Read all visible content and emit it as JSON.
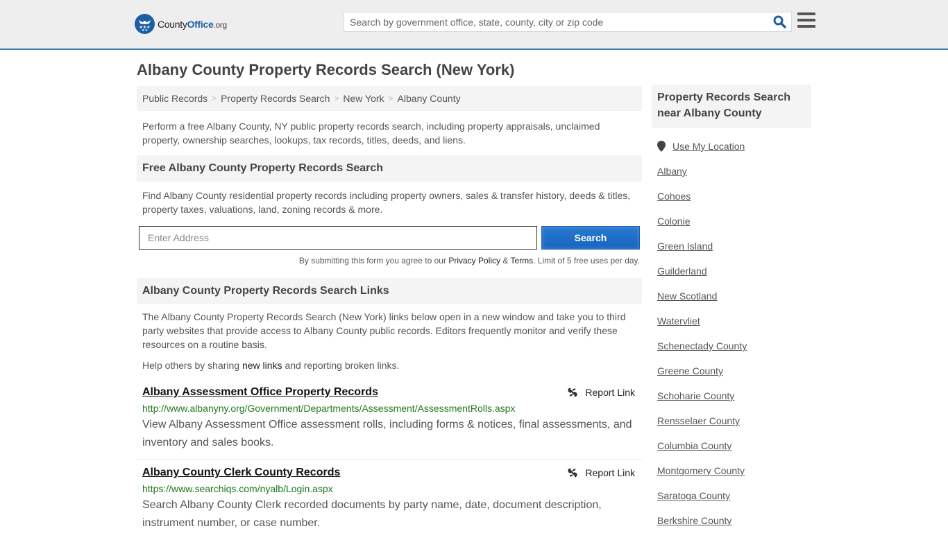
{
  "header": {
    "logo": {
      "county": "County",
      "office": "Office",
      "org": ".org"
    },
    "search_placeholder": "Search by government office, state, county, city or zip code",
    "brand_color": "#1d5fa5",
    "border_color": "#3a7cb0"
  },
  "page_title": "Albany County Property Records Search (New York)",
  "breadcrumb": [
    "Public Records",
    "Property Records Search",
    "New York",
    "Albany County"
  ],
  "intro": "Perform a free Albany County, NY public property records search, including property appraisals, unclaimed property, ownership searches, lookups, tax records, titles, deeds, and liens.",
  "free_search": {
    "heading": "Free Albany County Property Records Search",
    "description": "Find Albany County residential property records including property owners, sales & transfer history, deeds & titles, property taxes, valuations, land, zoning records & more.",
    "address_placeholder": "Enter Address",
    "button_label": "Search",
    "terms_prefix": "By submitting this form you agree to our ",
    "privacy_label": "Privacy Policy",
    "amp": " & ",
    "terms_label": "Terms",
    "terms_suffix": ". Limit of 5 free uses per day."
  },
  "links_section": {
    "heading": "Albany County Property Records Search Links",
    "description": "The Albany County Property Records Search (New York) links below open in a new window and take you to third party websites that provide access to Albany County public records. Editors frequently monitor and verify these resources on a routine basis.",
    "help_prefix": "Help others by sharing ",
    "help_link": "new links",
    "help_suffix": " and reporting broken links.",
    "report_label": "Report Link",
    "items": [
      {
        "title": "Albany Assessment Office Property Records",
        "url": "http://www.albanyny.org/Government/Departments/Assessment/AssessmentRolls.aspx",
        "description": "View Albany Assessment Office assessment rolls, including forms & notices, final assessments, and inventory and sales books."
      },
      {
        "title": "Albany County Clerk County Records",
        "url": "https://www.searchiqs.com/nyalb/Login.aspx",
        "description": "Search Albany County Clerk recorded documents by party name, date, document description, instrument number, or case number."
      }
    ]
  },
  "sidebar": {
    "heading": "Property Records Search near Albany County",
    "use_location": "Use My Location",
    "places": [
      "Albany",
      "Cohoes",
      "Colonie",
      "Green Island",
      "Guilderland",
      "New Scotland",
      "Watervliet",
      "Schenectady County",
      "Greene County",
      "Schoharie County",
      "Rensselaer County",
      "Columbia County",
      "Montgomery County",
      "Saratoga County",
      "Berkshire County"
    ]
  }
}
